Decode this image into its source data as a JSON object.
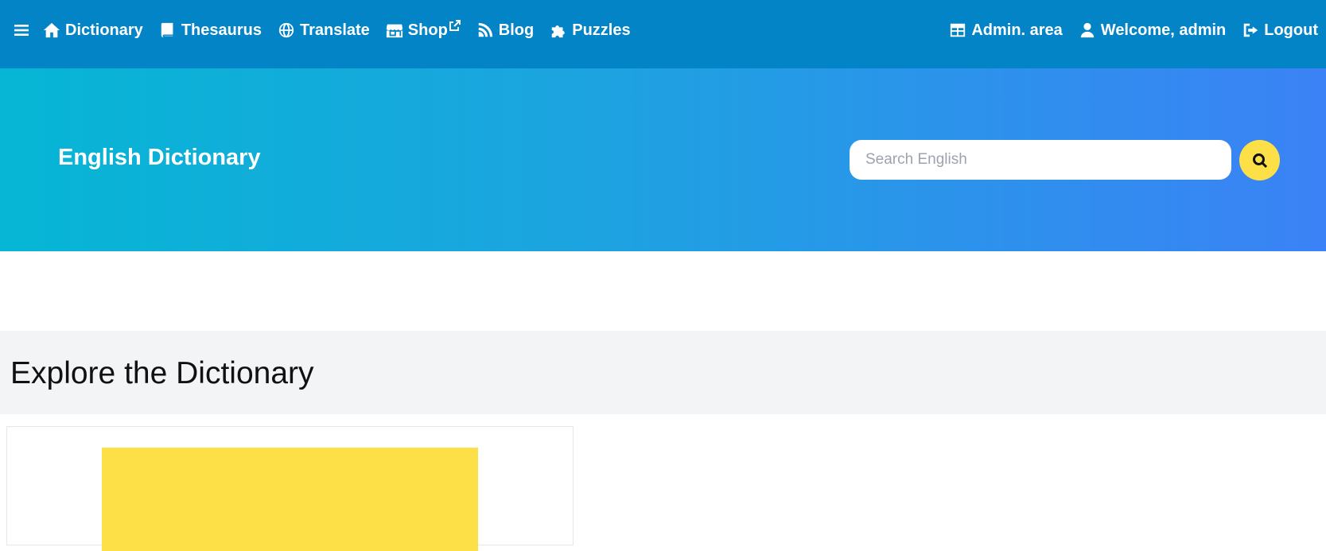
{
  "nav": {
    "left": [
      {
        "label": "Dictionary",
        "icon": "home-icon"
      },
      {
        "label": "Thesaurus",
        "icon": "book-icon"
      },
      {
        "label": "Translate",
        "icon": "globe-icon"
      },
      {
        "label": "Shop",
        "icon": "store-icon"
      },
      {
        "label": "Blog",
        "icon": "blog-icon"
      },
      {
        "label": "Puzzles",
        "icon": "puzzle-icon"
      }
    ],
    "right": [
      {
        "label": "Admin. area",
        "icon": "table-icon"
      },
      {
        "label": "Welcome, admin",
        "icon": "user-icon"
      },
      {
        "label": "Logout",
        "icon": "logout-icon"
      }
    ]
  },
  "hero": {
    "title": "English Dictionary",
    "search_placeholder": "Search English"
  },
  "explore": {
    "title": "Explore the Dictionary"
  },
  "colors": {
    "navbar": "#0284c7",
    "hero_start": "#06b6d4",
    "hero_end": "#3b82f6",
    "accent": "#fde047",
    "section_bg": "#f3f4f6"
  }
}
